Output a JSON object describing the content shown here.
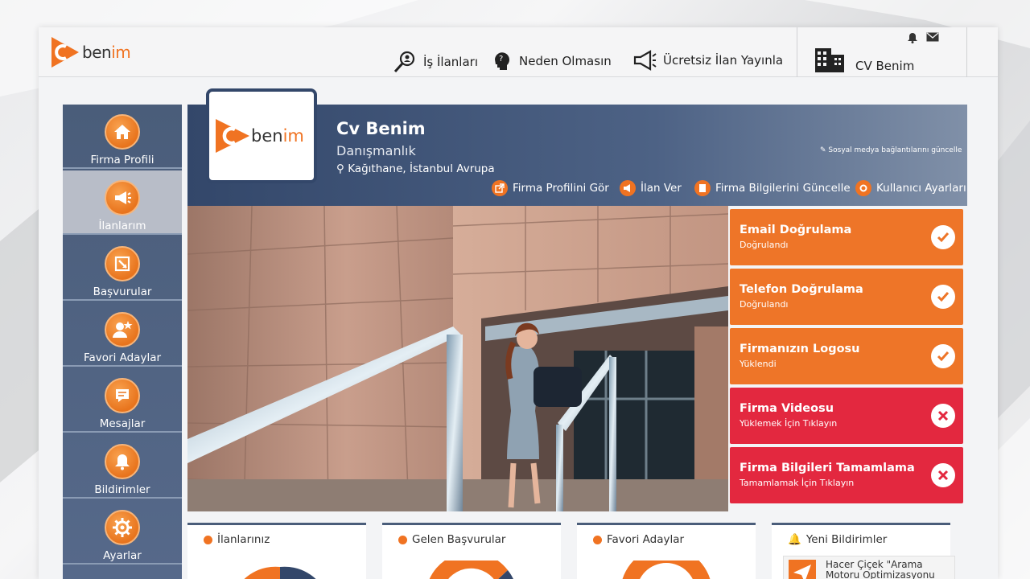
{
  "brand": {
    "logo_cv": "Cv",
    "logo_word_a": "ben",
    "logo_word_b": "im"
  },
  "nav": {
    "jobs": "İş İlanları",
    "why_not": "Neden Olmasın",
    "free_post": "Ücretsiz İlan Yayınla",
    "cv_benim": "CV Benim"
  },
  "sidebar": {
    "items": [
      {
        "label": "Firma Profili",
        "icon": "home-icon"
      },
      {
        "label": "İlanlarım",
        "icon": "megaphone-icon"
      },
      {
        "label": "Başvurular",
        "icon": "apply-icon"
      },
      {
        "label": "Favori Adaylar",
        "icon": "user-star-icon"
      },
      {
        "label": "Mesajlar",
        "icon": "message-icon"
      },
      {
        "label": "Bildirimler",
        "icon": "bell-icon"
      },
      {
        "label": "Ayarlar",
        "icon": "gear-icon"
      }
    ]
  },
  "profile": {
    "name": "Cv Benim",
    "type": "Danışmanlık",
    "location": "Kağıthane, İstanbul Avrupa",
    "social_link": "Sosyal medya bağlantılarını güncelle"
  },
  "actions": {
    "view_profile": "Firma Profilini Gör",
    "post_job": "İlan Ver",
    "update_info": "Firma Bilgilerini Güncelle",
    "user_settings": "Kullanıcı Ayarları"
  },
  "status_cards": [
    {
      "title": "Email Doğrulama",
      "sub": "Doğrulandı",
      "state": "ok"
    },
    {
      "title": "Telefon Doğrulama",
      "sub": "Doğrulandı",
      "state": "ok"
    },
    {
      "title": "Firmanızın Logosu",
      "sub": "Yüklendi",
      "state": "ok"
    },
    {
      "title": "Firma Videosu",
      "sub": "Yüklemek İçin Tıklayın",
      "state": "no"
    },
    {
      "title": "Firma Bilgileri Tamamlama",
      "sub": "Tamamlamak İçin Tıklayın",
      "state": "no"
    }
  ],
  "widgets": {
    "ads": "İlanlarınız",
    "applications": "Gelen Başvurular",
    "favorites": "Favori Adaylar",
    "notifications": "Yeni Bildirimler",
    "notification_preview": "Hacer Çiçek \"Arama Motoru Optimizasyonu"
  },
  "colors": {
    "accent": "#f07322",
    "navy": "#33476a",
    "ok": "#ee7528",
    "error": "#e3283f"
  }
}
